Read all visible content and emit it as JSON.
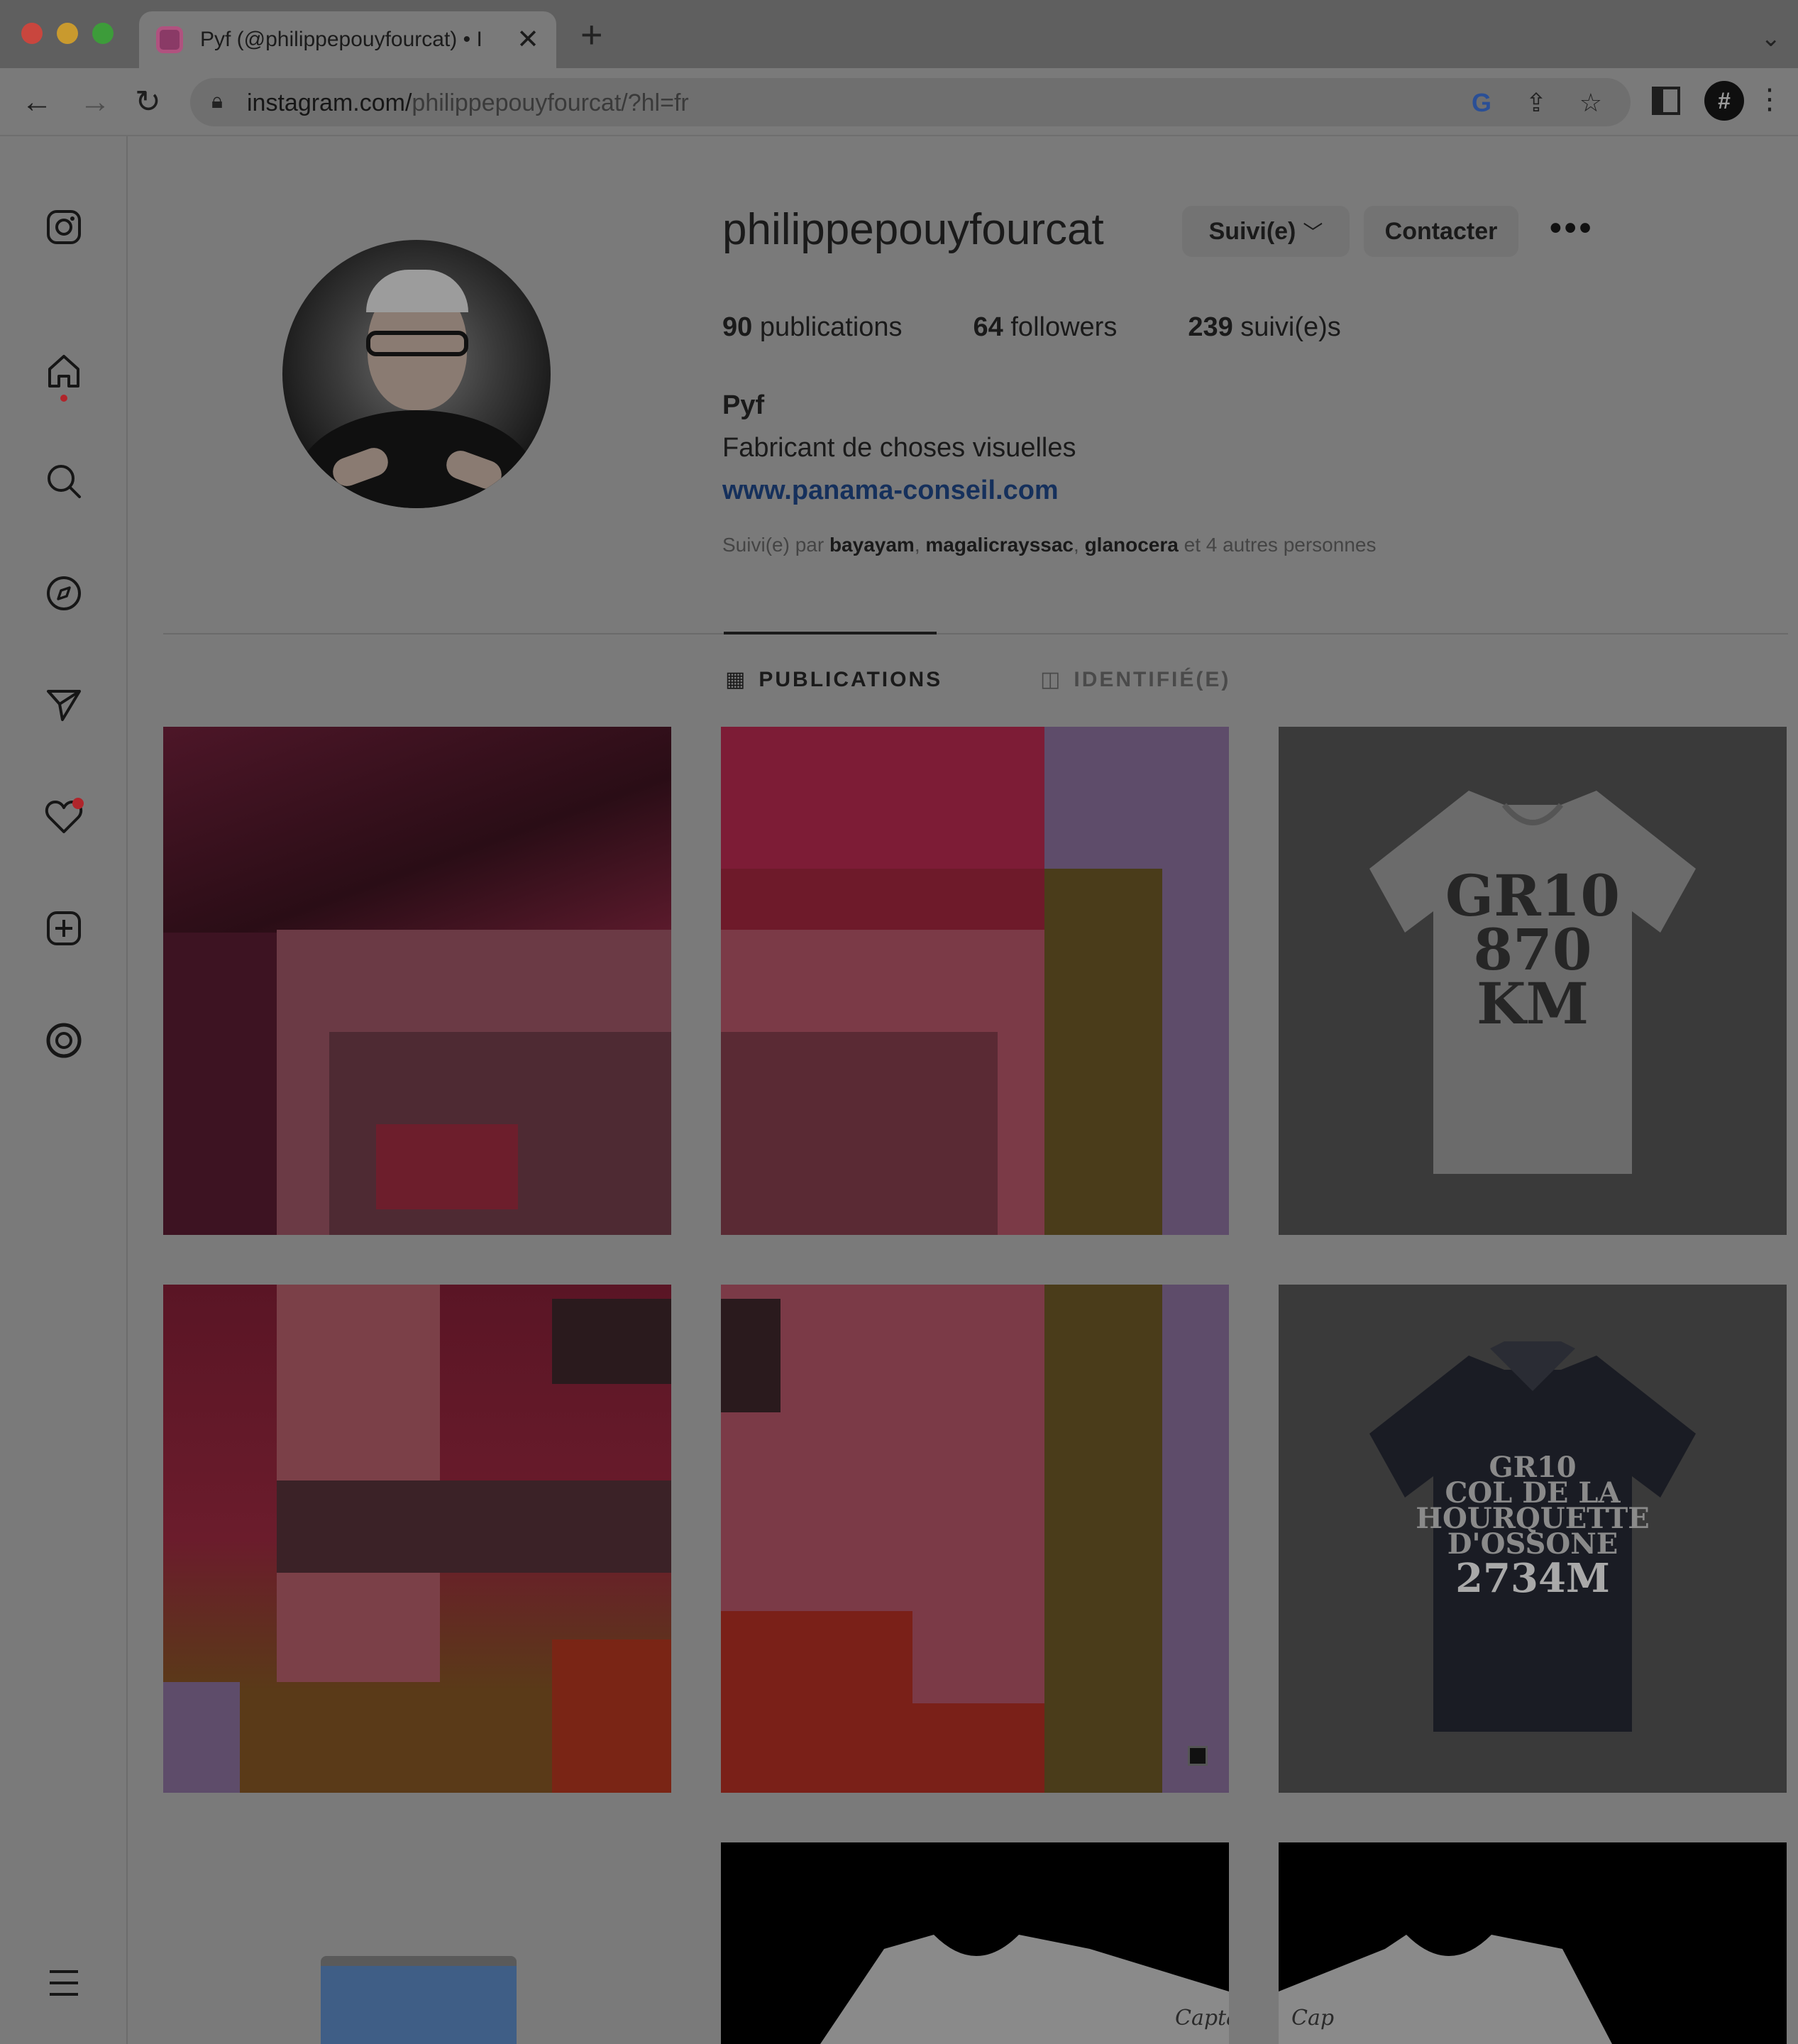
{
  "browser": {
    "tab_title": "Pyf (@philippepouyfourcat) • I",
    "tab_close": "✕",
    "new_tab": "+",
    "tab_menu": "⌄",
    "url_host": "instagram.com/",
    "url_path": "philippepouyfourcat/?hl=fr",
    "profile_initial": "#"
  },
  "profile": {
    "username": "philippepouyfourcat",
    "follow_label": "Suivi(e)",
    "contact_label": "Contacter",
    "more_label": "•••",
    "stats": {
      "posts_count": "90",
      "posts_label": "publications",
      "followers_count": "64",
      "followers_label": "followers",
      "following_count": "239",
      "following_label": "suivi(e)s"
    },
    "full_name": "Pyf",
    "bio": "Fabricant de choses visuelles",
    "website": "www.panama-conseil.com",
    "followed_by": {
      "prefix": "Suivi(e) par",
      "user1": "bayayam",
      "user2": "magalicrayssac",
      "user3": "glanocera",
      "suffix": "et 4 autres personnes"
    }
  },
  "tabs": {
    "publications": "PUBLICATIONS",
    "tagged": "IDENTIFIÉ(E)"
  },
  "posts": {
    "p3": {
      "line1": "GR10",
      "line2": "870",
      "line3": "KM"
    },
    "p6": {
      "line1": "GR10",
      "line2": "COL DE LA",
      "line3": "HOURQUETTE",
      "line4": "D'OSSONE",
      "line5": "2734M"
    },
    "p8": {
      "caption": "Captain"
    },
    "p9": {
      "caption": "Cap"
    }
  },
  "colors": {
    "overlay_bg": "#7a7a7a",
    "link": "#15305c",
    "notification": "#b0252b"
  }
}
